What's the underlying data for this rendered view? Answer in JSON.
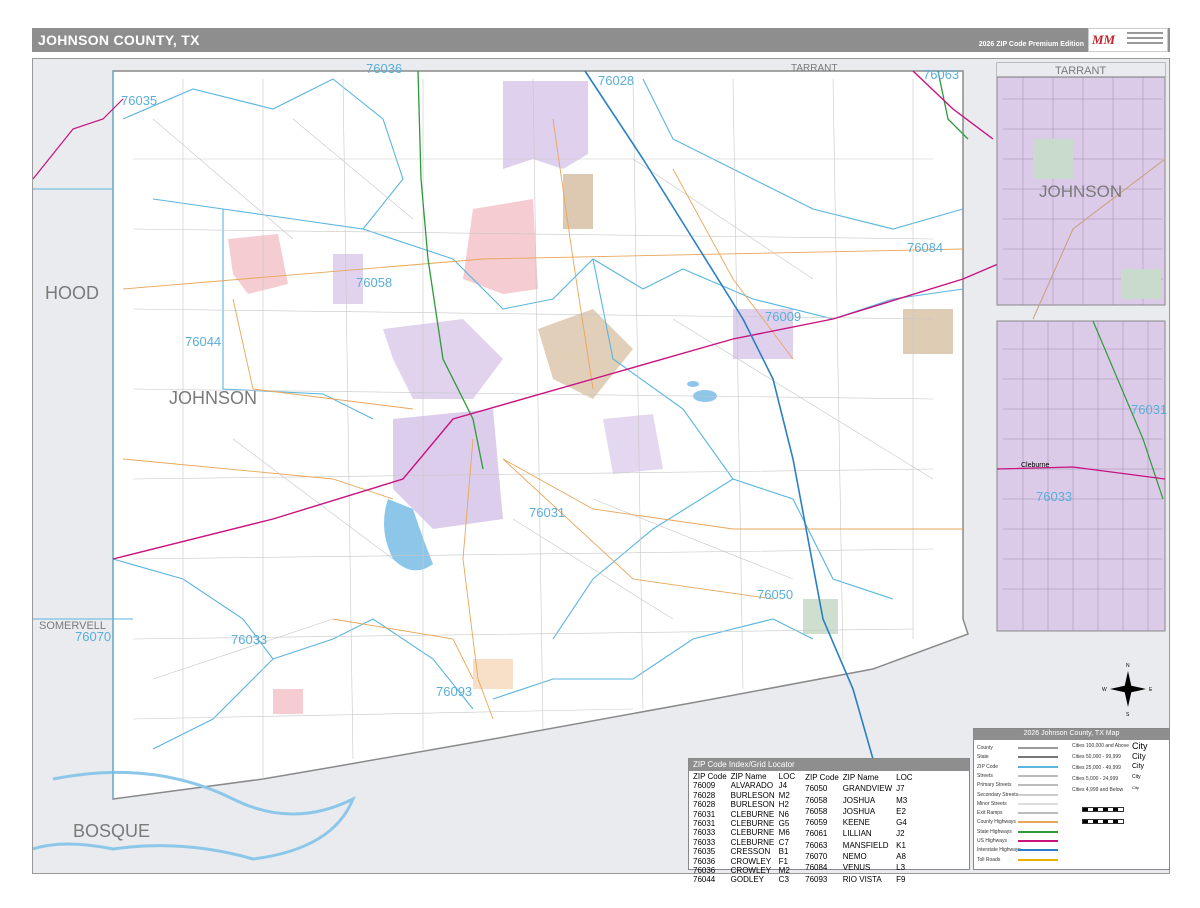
{
  "header": {
    "title": "JOHNSON COUNTY, TX",
    "edition": "2026 ZIP Code Premium Edition"
  },
  "map": {
    "county_labels": {
      "hood": "HOOD",
      "johnson": "JOHNSON",
      "somervell": "SOMERVELL",
      "bosque": "BOSQUE",
      "tarrant": "TARRANT"
    },
    "zip_labels": [
      {
        "zip": "76036",
        "id": "zip-76036-north"
      },
      {
        "zip": "76028",
        "id": "zip-76028"
      },
      {
        "zip": "76063",
        "id": "zip-76063"
      },
      {
        "zip": "76035",
        "id": "zip-76035"
      },
      {
        "zip": "76058",
        "id": "zip-76058"
      },
      {
        "zip": "76084",
        "id": "zip-76084"
      },
      {
        "zip": "76044",
        "id": "zip-76044"
      },
      {
        "zip": "76009",
        "id": "zip-76009"
      },
      {
        "zip": "76031",
        "id": "zip-76031"
      },
      {
        "zip": "76050",
        "id": "zip-76050"
      },
      {
        "zip": "76070",
        "id": "zip-76070"
      },
      {
        "zip": "76033",
        "id": "zip-76033"
      },
      {
        "zip": "76093",
        "id": "zip-76093"
      }
    ],
    "inset1": {
      "county_north": "TARRANT",
      "county": "JOHNSON"
    },
    "inset2": {
      "zip_a": "76031",
      "zip_b": "76033",
      "city": "Cleburne"
    },
    "compass": {
      "n": "N",
      "s": "S",
      "e": "E",
      "w": "W"
    }
  },
  "zip_index": {
    "title": "ZIP Code Index/Grid Locator",
    "headers": [
      "ZIP Code",
      "ZIP Name",
      "LOC"
    ],
    "left_rows": [
      [
        "76009",
        "ALVARADO",
        "J4"
      ],
      [
        "76028",
        "BURLESON",
        "M2"
      ],
      [
        "76028",
        "BURLESON",
        "H2"
      ],
      [
        "76031",
        "CLEBURNE",
        "N6"
      ],
      [
        "76031",
        "CLEBURNE",
        "G5"
      ],
      [
        "76033",
        "CLEBURNE",
        "M6"
      ],
      [
        "76033",
        "CLEBURNE",
        "C7"
      ],
      [
        "76035",
        "CRESSON",
        "B1"
      ],
      [
        "76036",
        "CROWLEY",
        "F1"
      ],
      [
        "76036",
        "CROWLEY",
        "M2"
      ],
      [
        "76044",
        "GODLEY",
        "C3"
      ]
    ],
    "right_rows": [
      [
        "76050",
        "GRANDVIEW",
        "J7"
      ],
      [
        "76058",
        "JOSHUA",
        "M3"
      ],
      [
        "76058",
        "JOSHUA",
        "E2"
      ],
      [
        "76059",
        "KEENE",
        "G4"
      ],
      [
        "76061",
        "LILLIAN",
        "J2"
      ],
      [
        "76063",
        "MANSFIELD",
        "K1"
      ],
      [
        "76070",
        "NEMO",
        "A8"
      ],
      [
        "76084",
        "VENUS",
        "L3"
      ],
      [
        "76093",
        "RIO VISTA",
        "F9"
      ]
    ]
  },
  "legend": {
    "title": "2026 Johnson County, TX Map",
    "rows": [
      "County",
      "State",
      "ZIP Code",
      "Streets",
      "Primary Streets",
      "Secondary Streets",
      "Minor Streets",
      "Exit Ramps",
      "County Highways",
      "State Highways",
      "US Highways",
      "Interstate Highways",
      "Toll Roads"
    ],
    "city_sizes": [
      "Cities 100,000 and Above",
      "Cities 50,000 - 99,999",
      "Cities 25,000 - 49,999",
      "Cities 5,000 - 24,999",
      "Cities 4,999 and Below"
    ],
    "city_samples": [
      "City",
      "City",
      "City",
      "City",
      "City"
    ]
  },
  "colors": {
    "county_outside": "#e9ebee",
    "zip_line": "#5ab6de",
    "interstate": "#2a7fc4",
    "us_highway": "#c8127f",
    "state_highway": "#2e9a3a",
    "county_highway": "#e8a65a",
    "city_purple": "#d9c8ea",
    "city_pink": "#f4c6cc",
    "city_tan": "#d9c3a8",
    "lake": "#8cc7ea",
    "titlebar": "#8e8e8e"
  }
}
